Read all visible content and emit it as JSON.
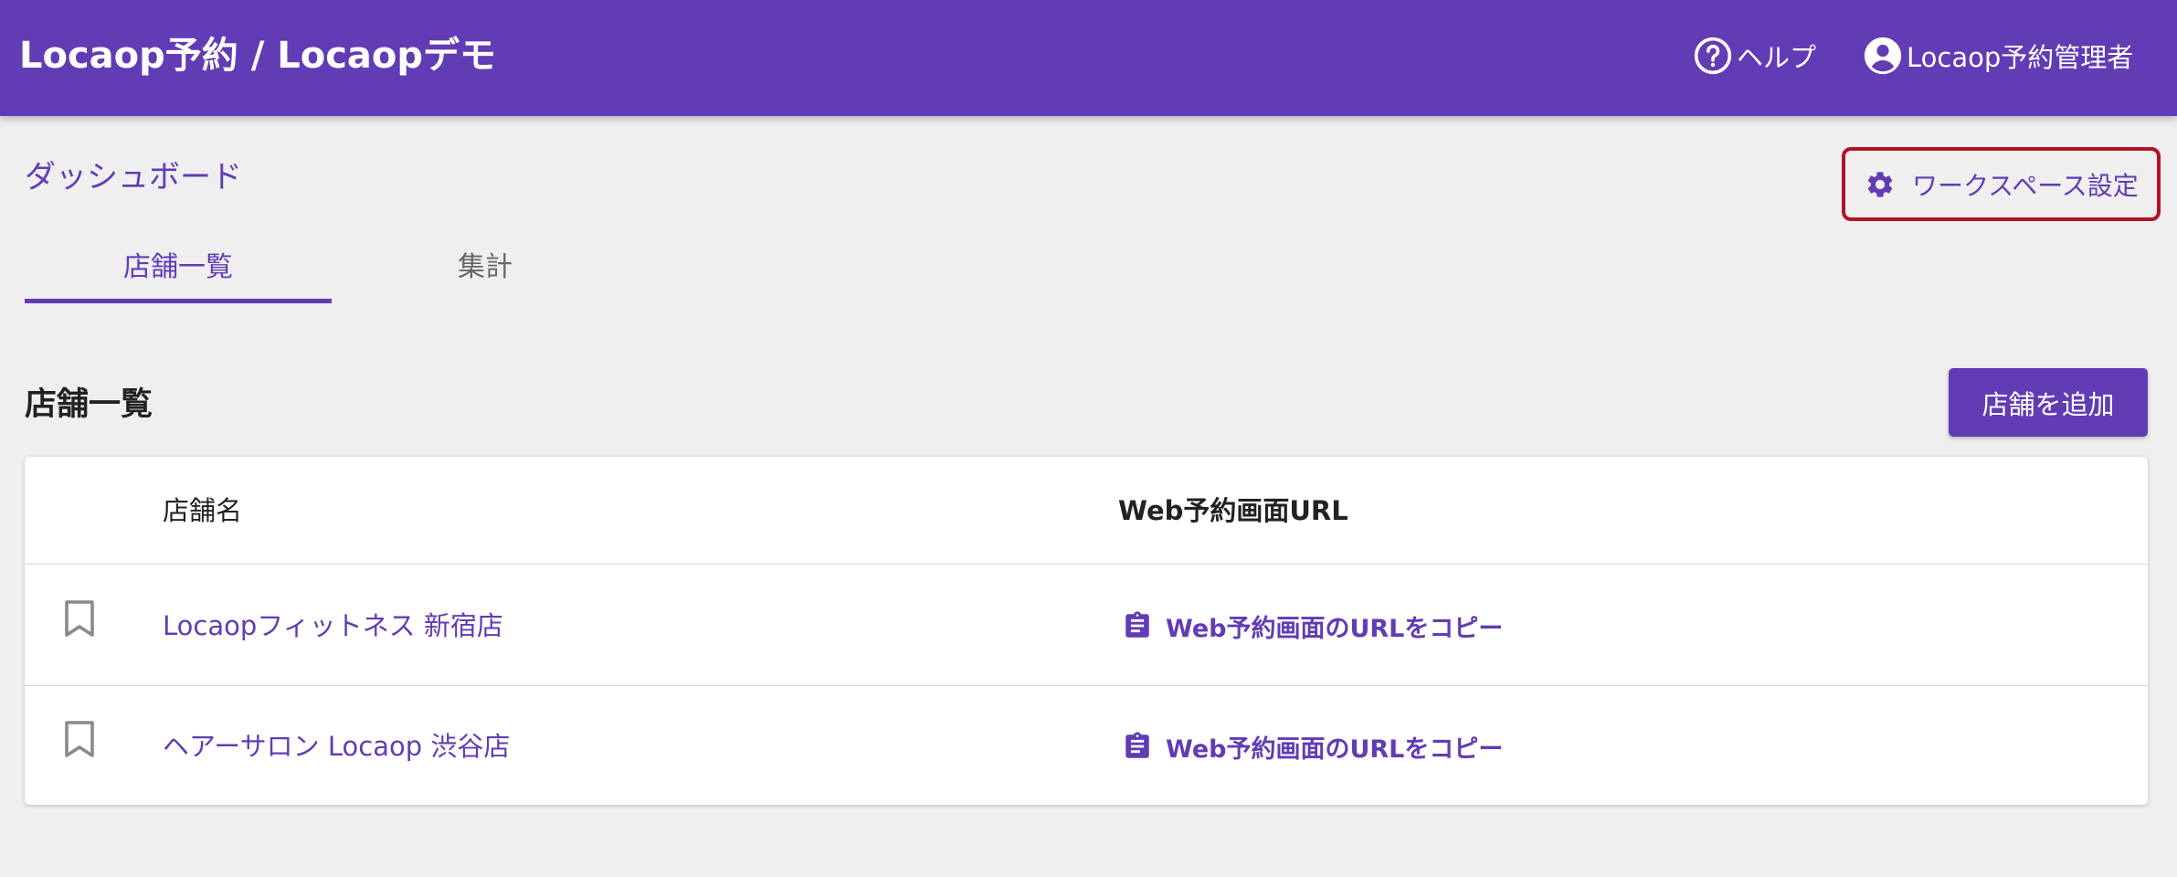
{
  "appbar": {
    "title": "Locaop予約 / Locaopデモ",
    "help_label": "ヘルプ",
    "account_label": "Locaop予約管理者"
  },
  "page": {
    "title": "ダッシュボード",
    "settings_label": "ワークスペース設定"
  },
  "tabs": [
    {
      "label": "店舗一覧",
      "active": true
    },
    {
      "label": "集計",
      "active": false
    }
  ],
  "section": {
    "title": "店舗一覧",
    "add_button_label": "店舗を追加"
  },
  "table": {
    "columns": [
      "店舗名",
      "Web予約画面URL"
    ],
    "rows": [
      {
        "name": "Locaopフィットネス 新宿店",
        "copy_label": "Web予約画面のURLをコピー"
      },
      {
        "name": "ヘアーサロン Locaop 渋谷店",
        "copy_label": "Web予約画面のURLをコピー"
      }
    ]
  },
  "icons": {
    "help": "help-circle-icon",
    "account": "account-circle-icon",
    "settings": "gear-icon",
    "bookmark": "bookmark-outline-icon",
    "copy": "clipboard-text-icon"
  },
  "colors": {
    "primary": "#613cb4",
    "highlight_border": "#b0142a",
    "background": "#efefef"
  }
}
